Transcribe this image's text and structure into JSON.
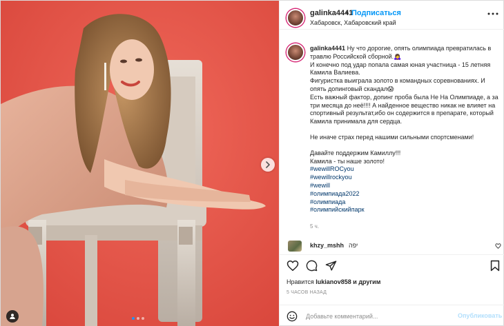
{
  "author": {
    "username": "galinka4441",
    "separator": "•",
    "follow_label": "Подписаться",
    "location": "Хабаровск, Хабаровский край"
  },
  "caption": {
    "username": "galinka4441",
    "lines": [
      "Ну что дорогие, опять олимпиада превратилась в травлю Российской сборной.🙇‍♀️",
      "И конечно под удар попала самая юная участница - 15 летняя Камила Валиева.",
      "Фигуристка выиграла золото в командных соревнованиях. И опять допинговый скандал😱",
      "Есть важный фактор, допинг проба была Не На Олимпиаде, а за три месяца до неё!!!! А найденное вещество никак не влияет на спортивный результат,ибо он содержится в препарате, который Камила принимала для сердца."
    ],
    "line2": "Не иначе страх перед нашими сильными спортсменами!",
    "line3": "Давайте поддержим Камиллу!!!",
    "line4": "Камила - ты наше золото!",
    "hashtags": [
      "#wewillROCyou",
      "#wewillrockyou",
      "#wewill",
      "#олимпиада2022",
      "#олимпиада",
      "#олимпийскийпарк"
    ],
    "time": "5 ч."
  },
  "comment": {
    "username": "khzy_mshh",
    "text": "יפה"
  },
  "likes": {
    "prefix": "Нравится",
    "user": "lukianov858",
    "suffix": "и другим"
  },
  "posted_time": "5 ЧАСОВ НАЗАД",
  "add_comment": {
    "placeholder": "Добавьте комментарий...",
    "publish_label": "Опубликовать"
  },
  "carousel": {
    "slides": 3,
    "active": 0
  },
  "icons": {
    "more": "more-horizontal-icon",
    "next": "chevron-right-icon",
    "tag": "user-tag-icon",
    "like": "heart-icon",
    "comment": "comment-icon",
    "share": "paper-plane-icon",
    "save": "bookmark-icon",
    "emoji": "smiley-icon"
  },
  "colors": {
    "accent": "#0095f6",
    "link": "#00376b",
    "muted": "#8e8e8e",
    "photo_background": "#e7574a"
  }
}
